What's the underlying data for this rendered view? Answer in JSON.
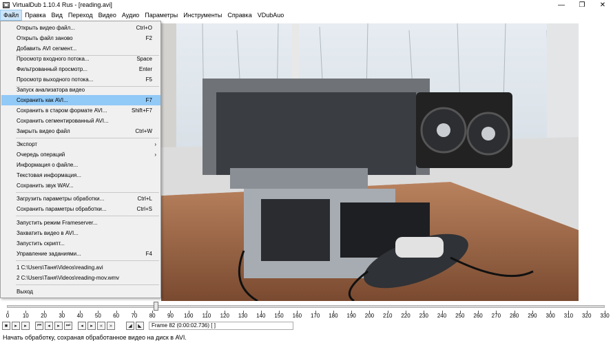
{
  "window": {
    "title": "VirtualDub 1.10.4 Rus - [reading.avi]",
    "minimize": "—",
    "restore": "❐",
    "close": "✕"
  },
  "menubar": [
    "Файл",
    "Правка",
    "Вид",
    "Переход",
    "Видео",
    "Аудио",
    "Параметры",
    "Инструменты",
    "Справка",
    "VDubAuo"
  ],
  "file_menu": {
    "items": [
      {
        "label": "Открыть видео файл...",
        "shortcut": "Ctrl+O"
      },
      {
        "label": "Открыть файл заново",
        "shortcut": "F2"
      },
      {
        "label": "Добавить AVI сегмент...",
        "shortcut": ""
      },
      {
        "label": "Просмотр входного потока...",
        "shortcut": "Space"
      },
      {
        "label": "Фильтрованный просмотр...",
        "shortcut": "Enter"
      },
      {
        "label": "Просмотр выходного потока...",
        "shortcut": "F5"
      },
      {
        "label": "Запуск анализатора видео",
        "shortcut": ""
      },
      {
        "label": "Сохранить как AVI...",
        "shortcut": "F7"
      },
      {
        "label": "Сохранить в старом формате AVI...",
        "shortcut": "Shift+F7"
      },
      {
        "label": "Сохранить сегментированный AVI...",
        "shortcut": ""
      },
      {
        "label": "Закрыть видео файл",
        "shortcut": "Ctrl+W"
      },
      {
        "label": "Экспорт",
        "shortcut": ""
      },
      {
        "label": "Очередь операций",
        "shortcut": ""
      },
      {
        "label": "Информация о файле...",
        "shortcut": ""
      },
      {
        "label": "Текстовая информация...",
        "shortcut": ""
      },
      {
        "label": "Сохранить звук WAV...",
        "shortcut": ""
      },
      {
        "label": "Загрузить параметры обработки...",
        "shortcut": "Ctrl+L"
      },
      {
        "label": "Сохранить параметры обработки...",
        "shortcut": "Ctrl+S"
      },
      {
        "label": "Запустить режим Frameserver...",
        "shortcut": ""
      },
      {
        "label": "Захватить видео в AVI...",
        "shortcut": ""
      },
      {
        "label": "Запустить скрипт...",
        "shortcut": ""
      },
      {
        "label": "Управление заданиями...",
        "shortcut": "F4"
      },
      {
        "label": "1 C:\\Users\\Таня\\Videos\\reading.avi",
        "shortcut": ""
      },
      {
        "label": "2 C:\\Users\\Таня\\Videos\\reading-mov.wmv",
        "shortcut": ""
      },
      {
        "label": "Выход",
        "shortcut": ""
      }
    ],
    "highlighted_index": 7
  },
  "timeline": {
    "ticks": [
      "0",
      "10",
      "20",
      "30",
      "40",
      "50",
      "60",
      "70",
      "80",
      "90",
      "100",
      "110",
      "120",
      "130",
      "140",
      "150",
      "160",
      "170",
      "180",
      "190",
      "200",
      "210",
      "220",
      "230",
      "240",
      "250",
      "260",
      "270",
      "280",
      "290",
      "300",
      "310",
      "320",
      "330"
    ],
    "current_frame": 82,
    "max": 330
  },
  "toolbar": {
    "frame_text": "Frame 82 (0:00:02.736) [ ]"
  },
  "status": {
    "text": "Начать обработку, сохраная обработанное видео на диск в AVI."
  }
}
